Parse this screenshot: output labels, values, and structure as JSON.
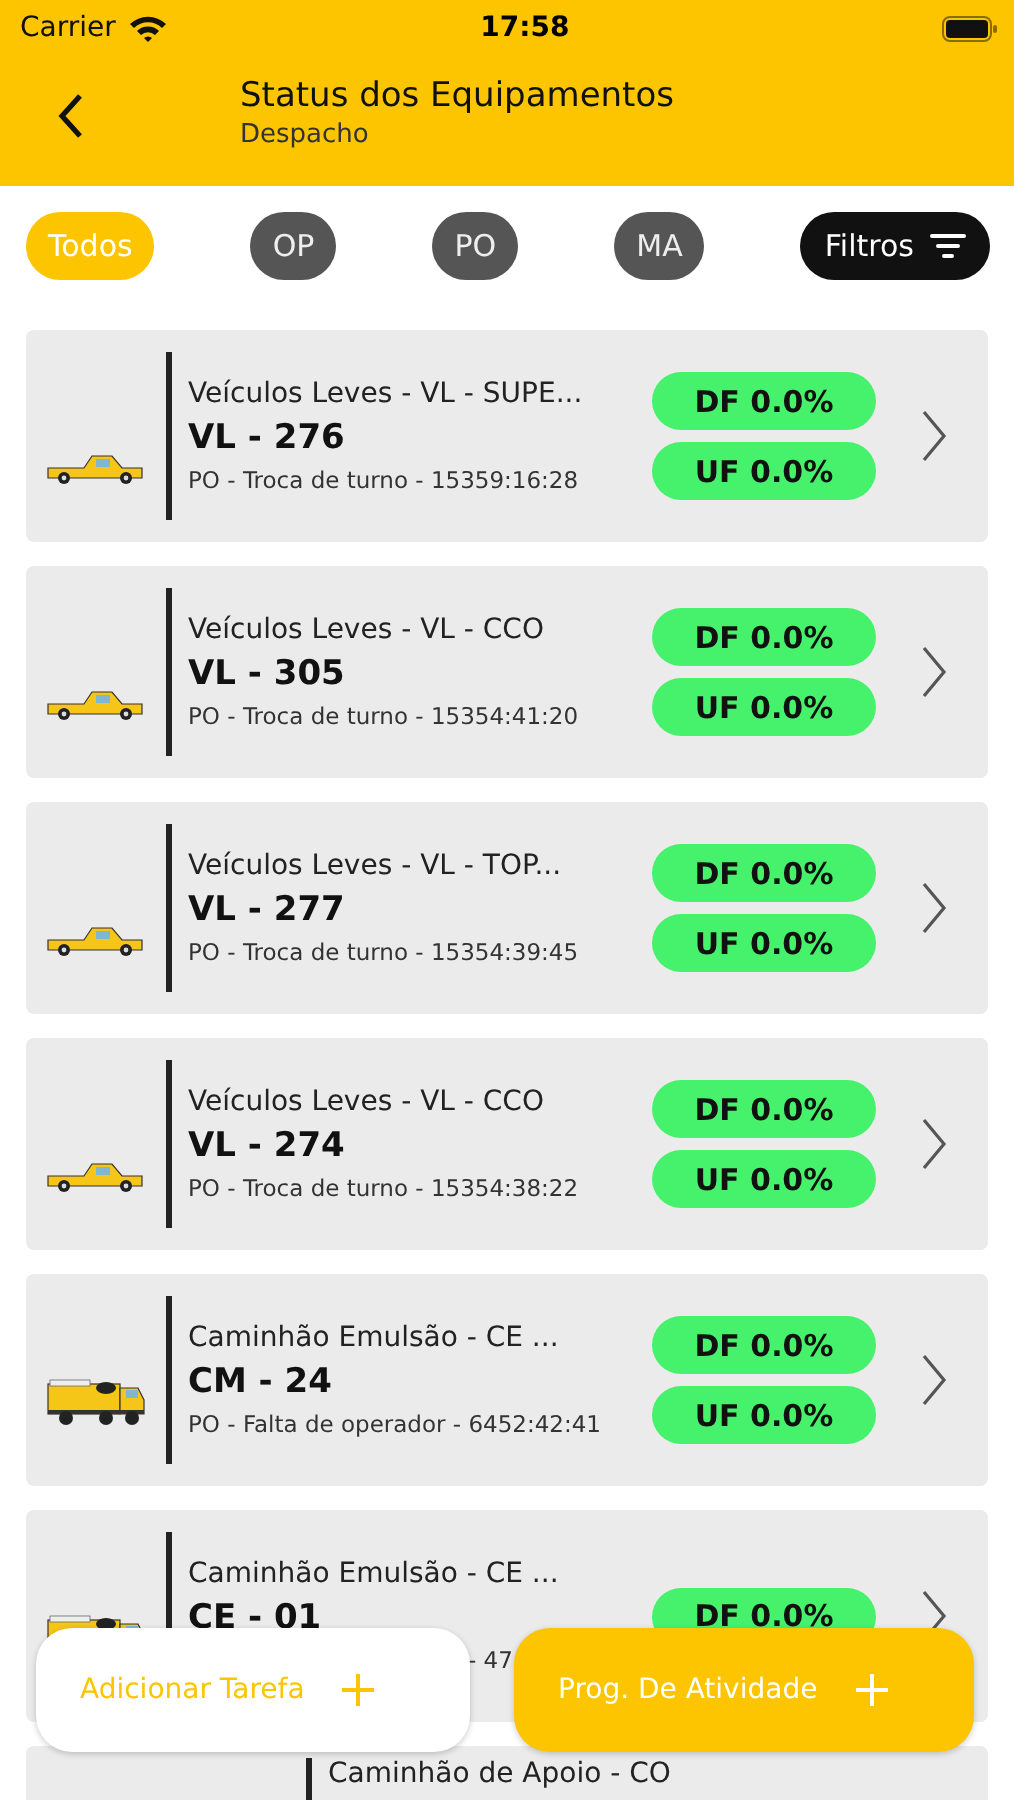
{
  "status_bar": {
    "carrier": "Carrier",
    "time": "17:58"
  },
  "header": {
    "title": "Status dos Equipamentos",
    "subtitle": "Despacho"
  },
  "filters": [
    {
      "label": "Todos",
      "selected": true
    },
    {
      "label": "OP",
      "selected": false
    },
    {
      "label": "PO",
      "selected": false
    },
    {
      "label": "MA",
      "selected": false
    }
  ],
  "filter_button": "Filtros",
  "equipment": [
    {
      "kind": "pickup",
      "category": "Veículos Leves - VL - SUPE...",
      "code": "VL - 276",
      "status": "PO - Troca de turno - 15359:16:28",
      "df": "DF 0.0%",
      "uf": "UF 0.0%"
    },
    {
      "kind": "pickup",
      "category": "Veículos Leves - VL - CCO",
      "code": "VL - 305",
      "status": "PO - Troca de turno - 15354:41:20",
      "df": "DF 0.0%",
      "uf": "UF 0.0%"
    },
    {
      "kind": "pickup",
      "category": "Veículos Leves - VL - TOP...",
      "code": "VL - 277",
      "status": "PO - Troca de turno - 15354:39:45",
      "df": "DF 0.0%",
      "uf": "UF 0.0%"
    },
    {
      "kind": "pickup",
      "category": "Veículos Leves - VL - CCO",
      "code": "VL - 274",
      "status": "PO - Troca de turno - 15354:38:22",
      "df": "DF 0.0%",
      "uf": "UF 0.0%"
    },
    {
      "kind": "truck",
      "category": "Caminhão Emulsão - CE ...",
      "code": "CM - 24",
      "status": "PO - Falta de operador - 6452:42:41",
      "df": "DF 0.0%",
      "uf": "UF 0.0%"
    },
    {
      "kind": "truck",
      "category": "Caminhão Emulsão - CE ...",
      "code": "CE - 01",
      "status_tail": "- 47",
      "df": "DF 0.0%"
    },
    {
      "kind": "cut",
      "category": "Caminhão de Apoio - CO"
    }
  ],
  "actions": [
    {
      "kind": "light",
      "label": "Adicionar Tarefa"
    },
    {
      "kind": "accent",
      "label": "Prog. De Atividade"
    }
  ]
}
